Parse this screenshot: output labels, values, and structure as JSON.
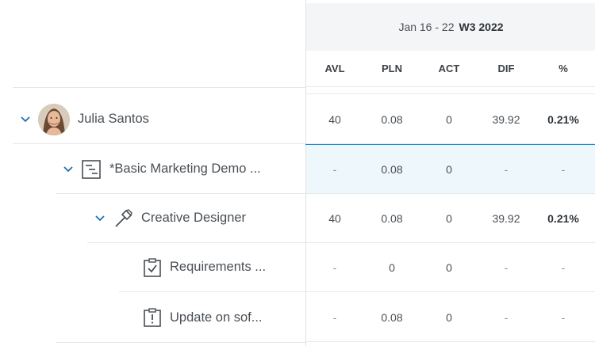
{
  "week": {
    "range": "Jan 16 - 22",
    "label": "W3 2022"
  },
  "columns": [
    "AVL",
    "PLN",
    "ACT",
    "DIF",
    "%"
  ],
  "rows": [
    {
      "label": "Julia Santos",
      "type": "user",
      "icon": "avatar",
      "values": [
        "40",
        "0.08",
        "0",
        "39.92",
        "0.21%"
      ]
    },
    {
      "label": "*Basic Marketing Demo ...",
      "type": "project",
      "icon": "project-icon",
      "values": [
        "-",
        "0.08",
        "0",
        "-",
        "-"
      ]
    },
    {
      "label": "Creative Designer",
      "type": "role",
      "icon": "hammer-icon",
      "values": [
        "40",
        "0.08",
        "0",
        "39.92",
        "0.21%"
      ]
    },
    {
      "label": "Requirements ...",
      "type": "task",
      "icon": "task-check-icon",
      "values": [
        "-",
        "0",
        "0",
        "-",
        "-"
      ]
    },
    {
      "label": "Update on sof...",
      "type": "task",
      "icon": "task-alert-icon",
      "values": [
        "-",
        "0.08",
        "0",
        "-",
        "-"
      ]
    }
  ],
  "colors": {
    "selection": "#1f8ccf",
    "selected_row_bg": "#eef7fc",
    "chevron": "#1f6fb2"
  }
}
